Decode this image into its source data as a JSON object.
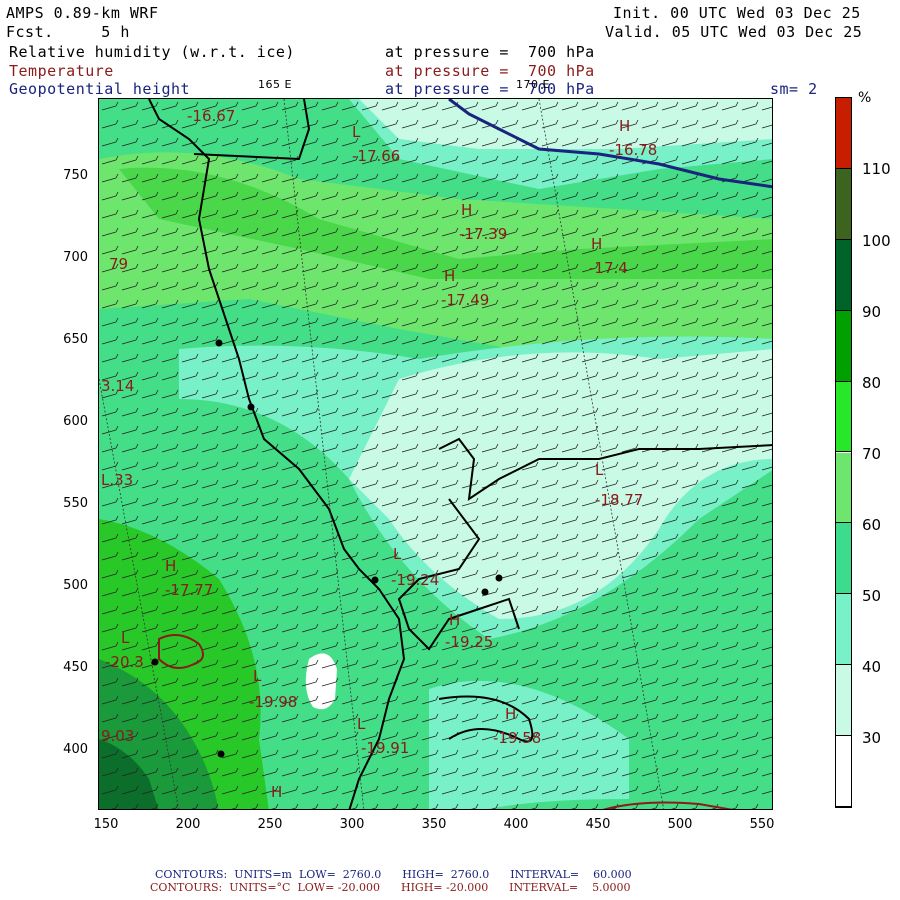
{
  "header": {
    "model": "AMPS 0.89-km WRF",
    "fcst": "Fcst.     5 h",
    "init": "Init. 00 UTC Wed 03 Dec 25",
    "valid": "Valid. 05 UTC Wed 03 Dec 25",
    "field1": "Relative humidity (w.r.t. ice)",
    "field2": "Temperature",
    "field3": "Geopotential height",
    "pressure1": "at pressure =  700 hPa",
    "pressure2": "at pressure =  700 hPa",
    "pressure3": "at pressure =  700 hPa",
    "lon1": "165 E",
    "lon2": "170 E",
    "sm": "sm= 2"
  },
  "axes": {
    "y_ticks": [
      "750",
      "700",
      "650",
      "600",
      "550",
      "500",
      "450",
      "400"
    ],
    "x_ticks": [
      "150",
      "200",
      "250",
      "300",
      "350",
      "400",
      "450",
      "500",
      "550"
    ]
  },
  "colorbar": {
    "unit": "%",
    "labels": [
      "110",
      "100",
      "90",
      "80",
      "70",
      "60",
      "50",
      "40",
      "30"
    ],
    "colors": [
      "#c81e00",
      "#3c641e",
      "#006428",
      "#00a000",
      "#28e628",
      "#6ee66e",
      "#3cdc8c",
      "#78f0c8",
      "#c8fae6",
      "#ffffff"
    ]
  },
  "map_labels": [
    {
      "text": "-16.67"
    },
    {
      "text": "L"
    },
    {
      "text": "-17.66"
    },
    {
      "text": "H"
    },
    {
      "text": "-16.78"
    },
    {
      "text": "H"
    },
    {
      "text": "-17.39"
    },
    {
      "text": "H"
    },
    {
      "text": "-17.4"
    },
    {
      "text": "H"
    },
    {
      "text": "-17.49"
    },
    {
      "text": "79"
    },
    {
      "text": "3.14"
    },
    {
      "text": "L"
    },
    {
      "text": "-18.77"
    },
    {
      "text": "L.33"
    },
    {
      "text": "H"
    },
    {
      "text": "-17.77"
    },
    {
      "text": "L"
    },
    {
      "text": "-19.24"
    },
    {
      "text": "H"
    },
    {
      "text": "-19.25"
    },
    {
      "text": "L"
    },
    {
      "text": "-20.3"
    },
    {
      "text": "L"
    },
    {
      "text": "-19.98"
    },
    {
      "text": "H"
    },
    {
      "text": "-19.58"
    },
    {
      "text": "9.03"
    },
    {
      "text": "L"
    },
    {
      "text": "-19.91"
    },
    {
      "text": "H"
    }
  ],
  "footer": {
    "line1_label": "CONTOURS:  UNITS=m  LOW=  2760.0      HIGH=  2760.0      INTERVAL=    60.000",
    "line2_label": "CONTOURS:  UNITS=°C  LOW= -20.000      HIGH= -20.000      INTERVAL=    5.0000"
  }
}
